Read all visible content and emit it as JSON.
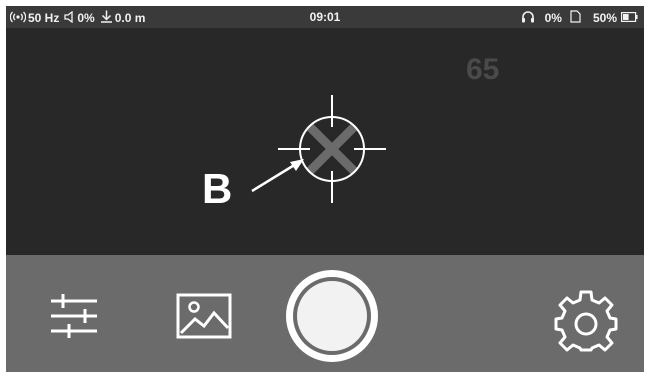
{
  "status_bar": {
    "hotspot_icon": "hotspot-icon",
    "frequency": "50 Hz",
    "volume_icon": "speaker-icon",
    "volume": "0%",
    "distance_icon": "download-arrow-icon",
    "distance": "0.0 m",
    "time": "09:01",
    "headphone_icon": "headphones-icon",
    "headphone_level": "0%",
    "storage_icon": "sd-card-icon",
    "battery": "50%",
    "battery_icon": "battery-icon",
    "battery_level": 0.5
  },
  "viewfinder": {
    "temperature_readout": "65",
    "crosshair_icon": "crosshair-icon",
    "callout_letter": "B"
  },
  "toolbar": {
    "adjust_icon": "sliders-icon",
    "gallery_icon": "image-icon",
    "shutter_icon": "shutter-button",
    "settings_icon": "gear-icon"
  },
  "colors": {
    "background": "#262626",
    "status_bar": "#3a3a3a",
    "toolbar": "#6b6b6b",
    "text": "#f2f2f2",
    "crosshair_x": "#6b6b6b"
  }
}
